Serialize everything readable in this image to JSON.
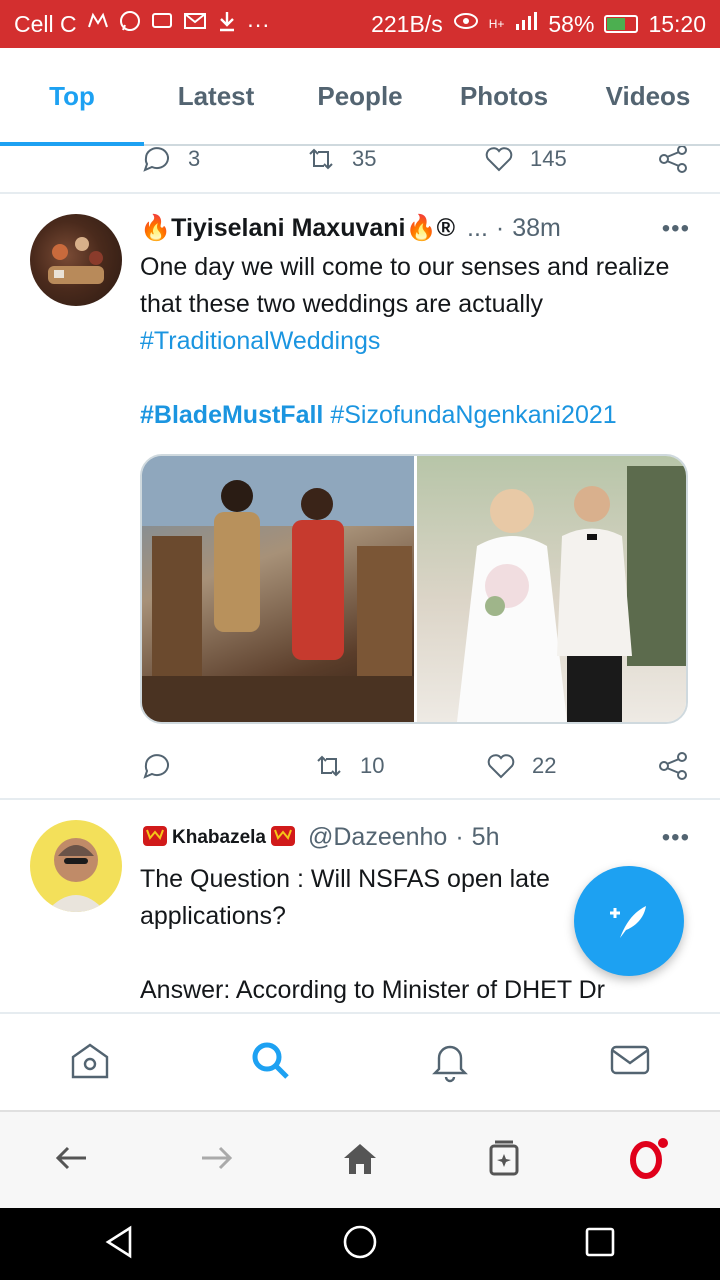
{
  "status_bar": {
    "carrier": "Cell C",
    "notif_icons": [
      "app-icon",
      "whatsapp-icon",
      "sms-icon",
      "gmail-icon",
      "download-icon"
    ],
    "more": "···",
    "network_speed": "221B/s",
    "network_type": "H+",
    "battery": "58%",
    "battery_level": 0.58,
    "time": "15:20"
  },
  "tabs": [
    {
      "label": "Top",
      "active": true
    },
    {
      "label": "Latest"
    },
    {
      "label": "People"
    },
    {
      "label": "Photos"
    },
    {
      "label": "Videos"
    }
  ],
  "previous_tweet_actions": {
    "replies": "3",
    "retweets": "35",
    "likes": "145"
  },
  "tweets": [
    {
      "name": "🔥Tiyiselani Maxuvani🔥®",
      "truncation": "...",
      "separator": "·",
      "time": "38m",
      "more": "•••",
      "text": "One day we will come to our senses and realize that these two weddings are actually",
      "hashtag1": "#TraditionalWeddings",
      "hashtag2": "#BladeMustFall",
      "hashtag3": "#SizofundaNgenkani2021",
      "replies": "",
      "retweets": "10",
      "likes": "22"
    },
    {
      "name": "Khabazela",
      "handle": "@Dazeenho",
      "separator": "·",
      "time": "5h",
      "more": "•••",
      "text1": "The Question : Will NSFAS open late applications?",
      "text2": "Answer: According to Minister of DHET Dr"
    }
  ],
  "colors": {
    "accent": "#1da1f2",
    "status_bar": "#d32f2f",
    "opera": "#e0001b"
  }
}
